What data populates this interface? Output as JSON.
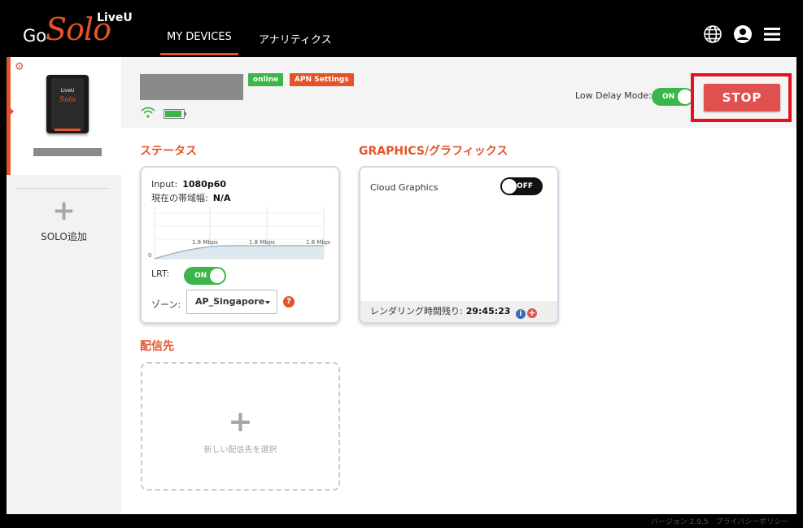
{
  "app": {
    "logo_go": "Go",
    "logo_solo": "Solo",
    "logo_liveu": "LiveU"
  },
  "nav": {
    "tabs": [
      {
        "label": "MY DEVICES",
        "active": true
      },
      {
        "label": "アナリティクス",
        "active": false
      }
    ]
  },
  "topbar_icons": [
    "globe-icon",
    "user-icon",
    "menu-icon"
  ],
  "sidebar": {
    "device": {
      "label_top": "LiveU",
      "label_model": "Solo"
    },
    "add_label": "SOLO追加",
    "add_symbol": "+"
  },
  "header": {
    "status_badge": "online",
    "apn_badge": "APN Settings",
    "low_delay_label": "Low Delay Mode:",
    "low_delay_toggle": "ON",
    "stop_button": "STOP"
  },
  "status": {
    "title": "ステータス",
    "input_label": "Input:",
    "input_value": "1080p60",
    "bandwidth_label": "現在の帯域幅:",
    "bandwidth_value": "N/A",
    "chart_labels": [
      "1.8 Mbps",
      "1.8 Mbps",
      "1.8 Mbps"
    ],
    "chart_zero": "0",
    "lrt_label": "LRT:",
    "lrt_toggle": "ON",
    "zone_label": "ゾーン:",
    "zone_value": "AP_Singapore",
    "help_symbol": "?"
  },
  "graphics": {
    "title": "GRAPHICS/グラフィックス",
    "cloud_label": "Cloud Graphics",
    "cloud_toggle": "OFF",
    "render_label": "レンダリング時間残り:",
    "render_value": "29:45:23",
    "info_symbol": "i",
    "plus_symbol": "+"
  },
  "destination": {
    "title": "配信先",
    "add_symbol": "+",
    "add_label": "新しい配信先を選択"
  },
  "footer": "バージョン 2.9.5　プライバシーポリシー",
  "colors": {
    "accent": "#e4542a",
    "online": "#3cb54a",
    "stop": "#e0504f",
    "highlight": "#e8101a"
  }
}
